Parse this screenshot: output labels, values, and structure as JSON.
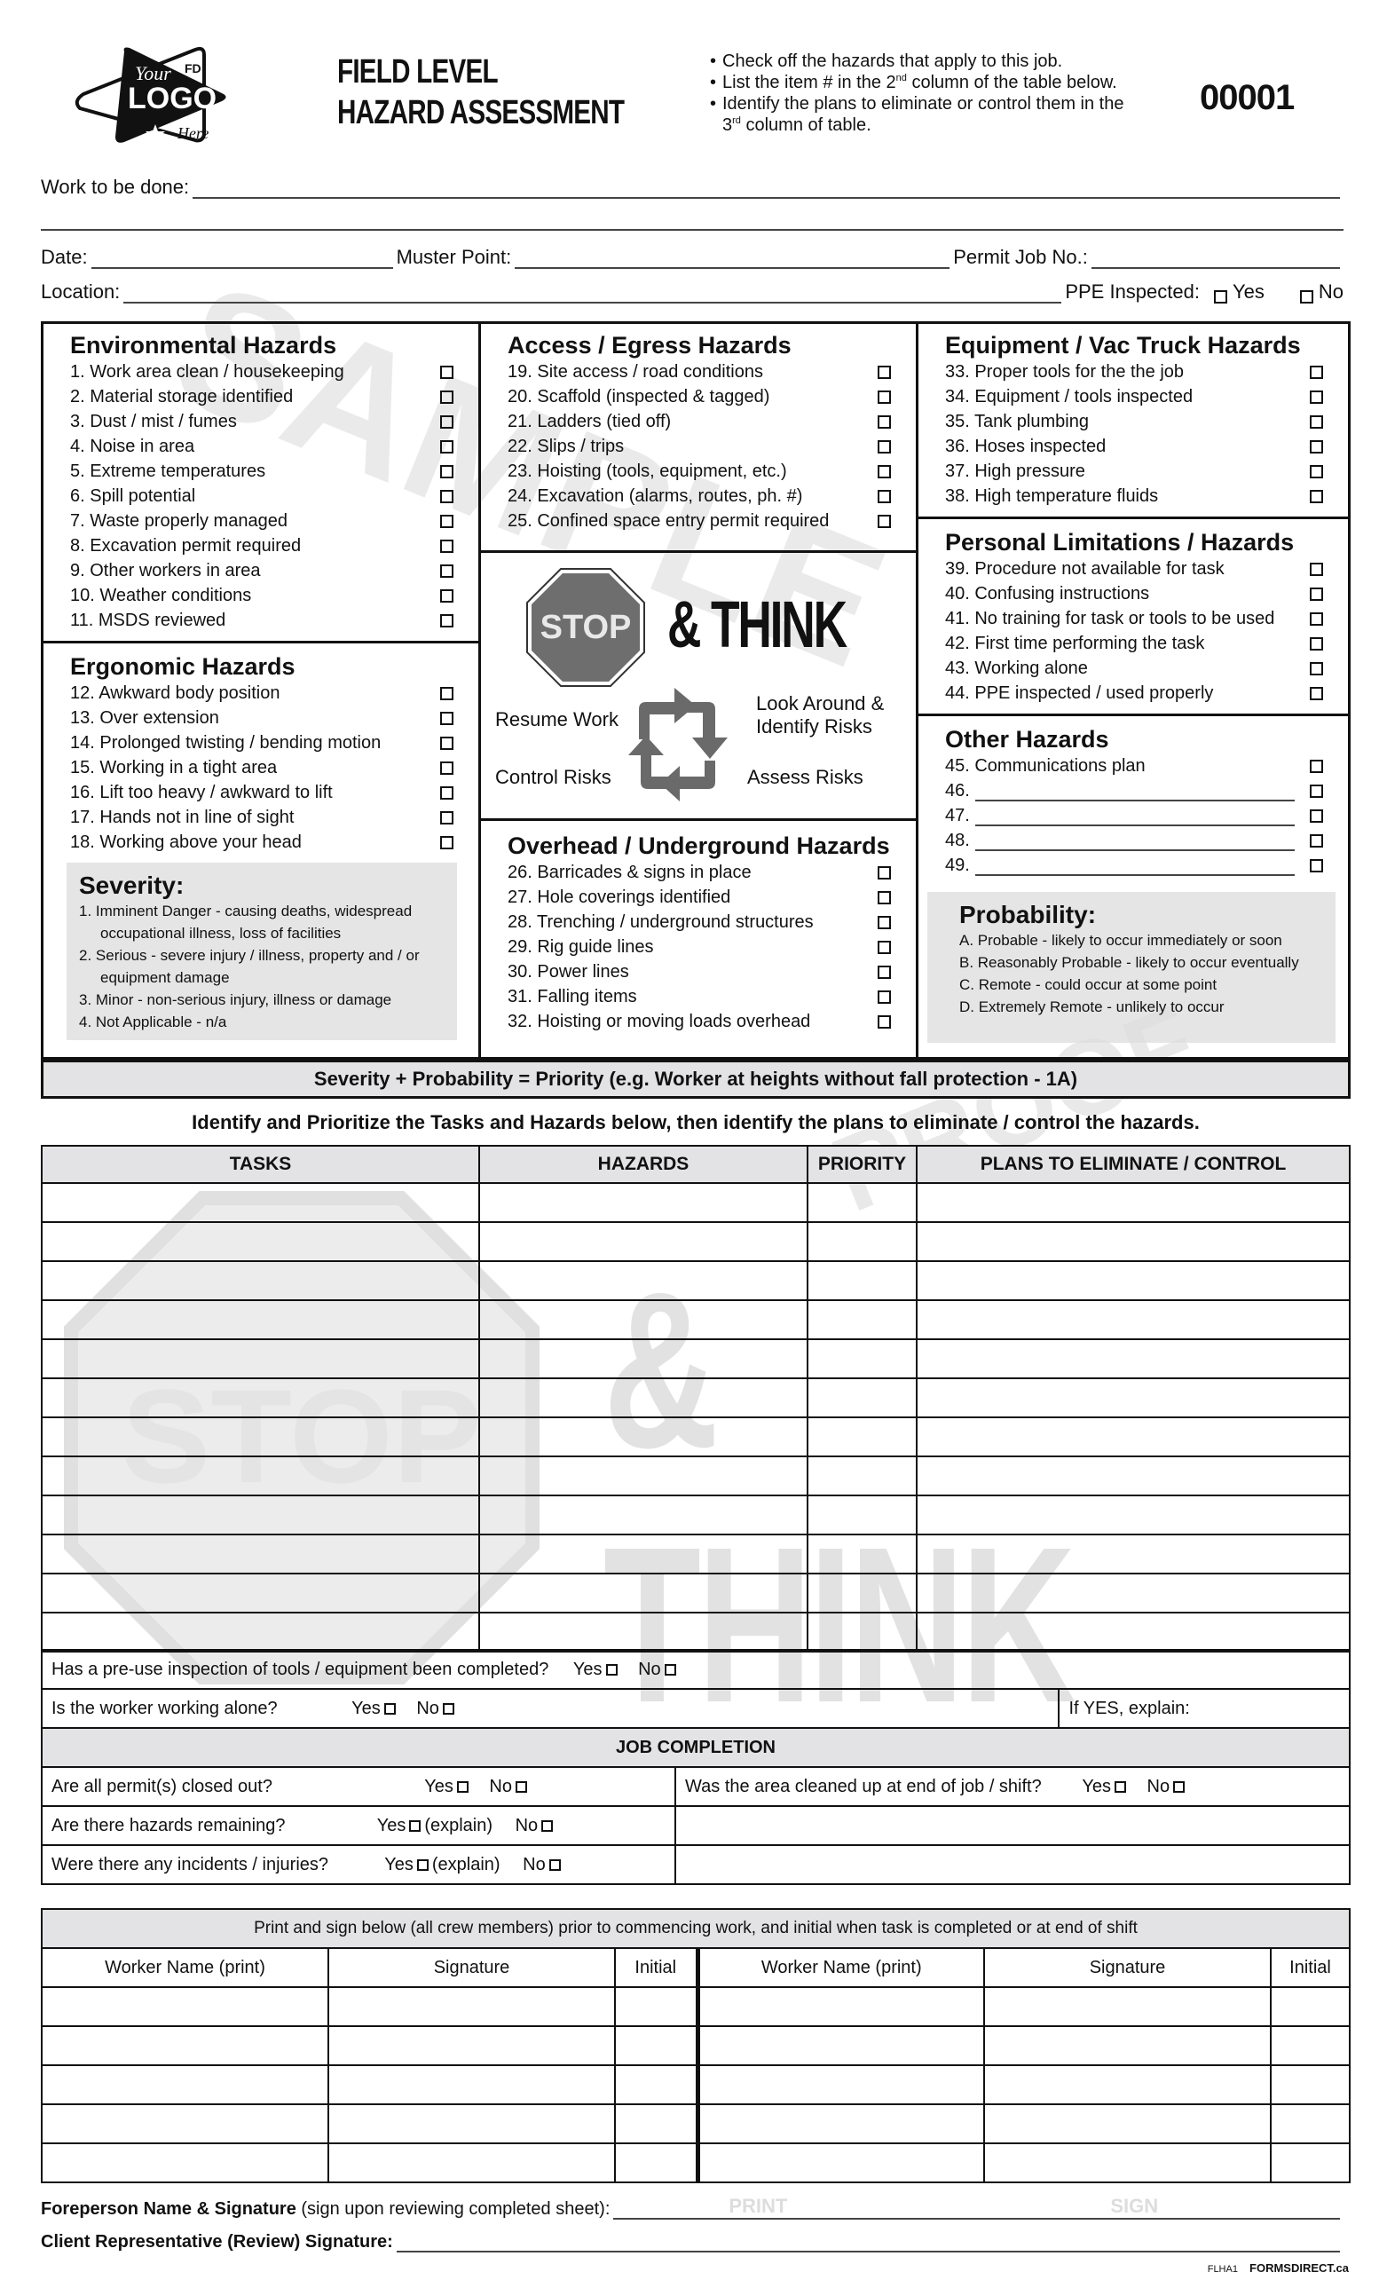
{
  "logo": {
    "line1": "Your",
    "line2": "LOGO",
    "line3": "Here",
    "badge": "FD"
  },
  "header": {
    "title_line1": "FIELD LEVEL",
    "title_line2": "HAZARD ASSESSMENT",
    "instructions": [
      "Check off the hazards that apply to this job.",
      "List the item # in the 2nd column of the table below.",
      "Identify the plans to eliminate or control them in the 3rd column of table."
    ],
    "instr1": "Check off the hazards that apply to this job.",
    "instr2a": "List the item # in the 2",
    "instr2sup": "nd",
    "instr2b": " column of the table below.",
    "instr3a": "Identify the plans to eliminate or control them in the",
    "instr3b": "3",
    "instr3sup": "rd",
    "instr3c": " column of table.",
    "serial": "00001"
  },
  "fields": {
    "work": "Work to be done:",
    "date": "Date:",
    "muster": "Muster Point:",
    "permit": "Permit Job No.:",
    "location": "Location:",
    "ppe": "PPE Inspected:",
    "yes": "Yes",
    "no": "No"
  },
  "sections": {
    "environmental": {
      "title": "Environmental Hazards",
      "items": [
        "1. Work area clean / housekeeping",
        "2. Material storage identified",
        "3. Dust / mist / fumes",
        "4. Noise in area",
        "5. Extreme temperatures",
        "6. Spill potential",
        "7. Waste properly managed",
        "8. Excavation permit required",
        "9. Other workers in area",
        "10. Weather conditions",
        "11. MSDS reviewed"
      ]
    },
    "ergonomic": {
      "title": "Ergonomic Hazards",
      "items": [
        "12. Awkward body position",
        "13. Over extension",
        "14. Prolonged twisting / bending motion",
        "15. Working in a tight area",
        "16. Lift too heavy / awkward to lift",
        "17. Hands not in line of sight",
        "18. Working above your head"
      ]
    },
    "access": {
      "title": "Access / Egress Hazards",
      "items": [
        "19. Site access / road conditions",
        "20. Scaffold (inspected & tagged)",
        "21. Ladders (tied off)",
        "22. Slips / trips",
        "23. Hoisting (tools, equipment, etc.)",
        "24. Excavation (alarms, routes, ph. #)",
        "25. Confined space entry permit required"
      ]
    },
    "overhead": {
      "title": "Overhead / Underground Hazards",
      "items": [
        "26. Barricades & signs in place",
        "27. Hole coverings identified",
        "28. Trenching / underground structures",
        "29. Rig guide lines",
        "30. Power lines",
        "31. Falling items",
        "32. Hoisting or moving loads overhead"
      ]
    },
    "equipment": {
      "title": "Equipment / Vac Truck Hazards",
      "items": [
        "33. Proper tools for the the job",
        "34. Equipment / tools inspected",
        "35. Tank plumbing",
        "36. Hoses inspected",
        "37. High pressure",
        "38. High temperature fluids"
      ]
    },
    "personal": {
      "title": "Personal Limitations / Hazards",
      "items": [
        "39. Procedure not available for task",
        "40. Confusing instructions",
        "41. No training for task or tools to be used",
        "42. First time performing the task",
        "43. Working alone",
        "44. PPE inspected / used properly"
      ]
    },
    "other": {
      "title": "Other Hazards",
      "items": [
        "45. Communications plan",
        "46.",
        "47.",
        "48.",
        "49."
      ]
    }
  },
  "severity": {
    "title": "Severity:",
    "s1a": "1. Imminent Danger - causing deaths, widespread",
    "s1b": "occupational illness, loss of facilities",
    "s2a": "2. Serious - severe injury / illness, property and / or",
    "s2b": "equipment damage",
    "s3": "3. Minor - non-serious injury, illness or damage",
    "s4": "4. Not Applicable - n/a"
  },
  "probability": {
    "title": "Probability:",
    "items": [
      "A. Probable - likely to occur immediately or soon",
      "B. Reasonably Probable - likely to occur eventually",
      "C. Remote - could occur at some point",
      "D. Extremely Remote - unlikely to occur"
    ]
  },
  "stop_think": {
    "stop": "STOP",
    "think": "& THINK",
    "resume": "Resume Work",
    "look": "Look Around &",
    "identify": "Identify Risks",
    "control": "Control Risks",
    "assess": "Assess Risks"
  },
  "priority_bar": "Severity + Probability = Priority (e.g. Worker at heights without fall protection - 1A)",
  "identify_line": "Identify and Prioritize the Tasks and Hazards below, then identify the plans to eliminate / control the hazards.",
  "tasks_table": {
    "headers": [
      "TASKS",
      "HAZARDS",
      "PRIORITY",
      "PLANS TO ELIMINATE / CONTROL"
    ],
    "row_count": 12
  },
  "questions": {
    "preuse": "Has a pre-use inspection of tools / equipment been completed?",
    "alone": "Is the worker working alone?",
    "if_yes": "If YES, explain:",
    "job_completion": "JOB COMPLETION",
    "permits": "Are all permit(s) closed out?",
    "cleaned": "Was the area cleaned up at end of job / shift?",
    "remaining": "Are there hazards remaining?",
    "incidents": "Were there any incidents / injuries?",
    "yes": "Yes",
    "no": "No",
    "explain": "(explain)"
  },
  "signatures": {
    "instruction": "Print and sign below (all crew members) prior to commencing work, and initial when task is completed or at end of shift",
    "headers": [
      "Worker Name (print)",
      "Signature",
      "Initial",
      "Worker Name (print)",
      "Signature",
      "Initial"
    ],
    "row_count": 5
  },
  "footer": {
    "foreperson_bold": "Foreperson Name & Signature",
    "foreperson_note": " (sign upon reviewing completed sheet):",
    "print_hint": "PRINT",
    "sign_hint": "SIGN",
    "client": "Client Representative (Review) Signature:",
    "form_code": "FLHA1",
    "brand": "FORMSDIRECT.ca"
  },
  "watermarks": {
    "sample": "SAMPLE",
    "proof": "PROOF",
    "stop": "STOP",
    "think": "& THINK"
  }
}
